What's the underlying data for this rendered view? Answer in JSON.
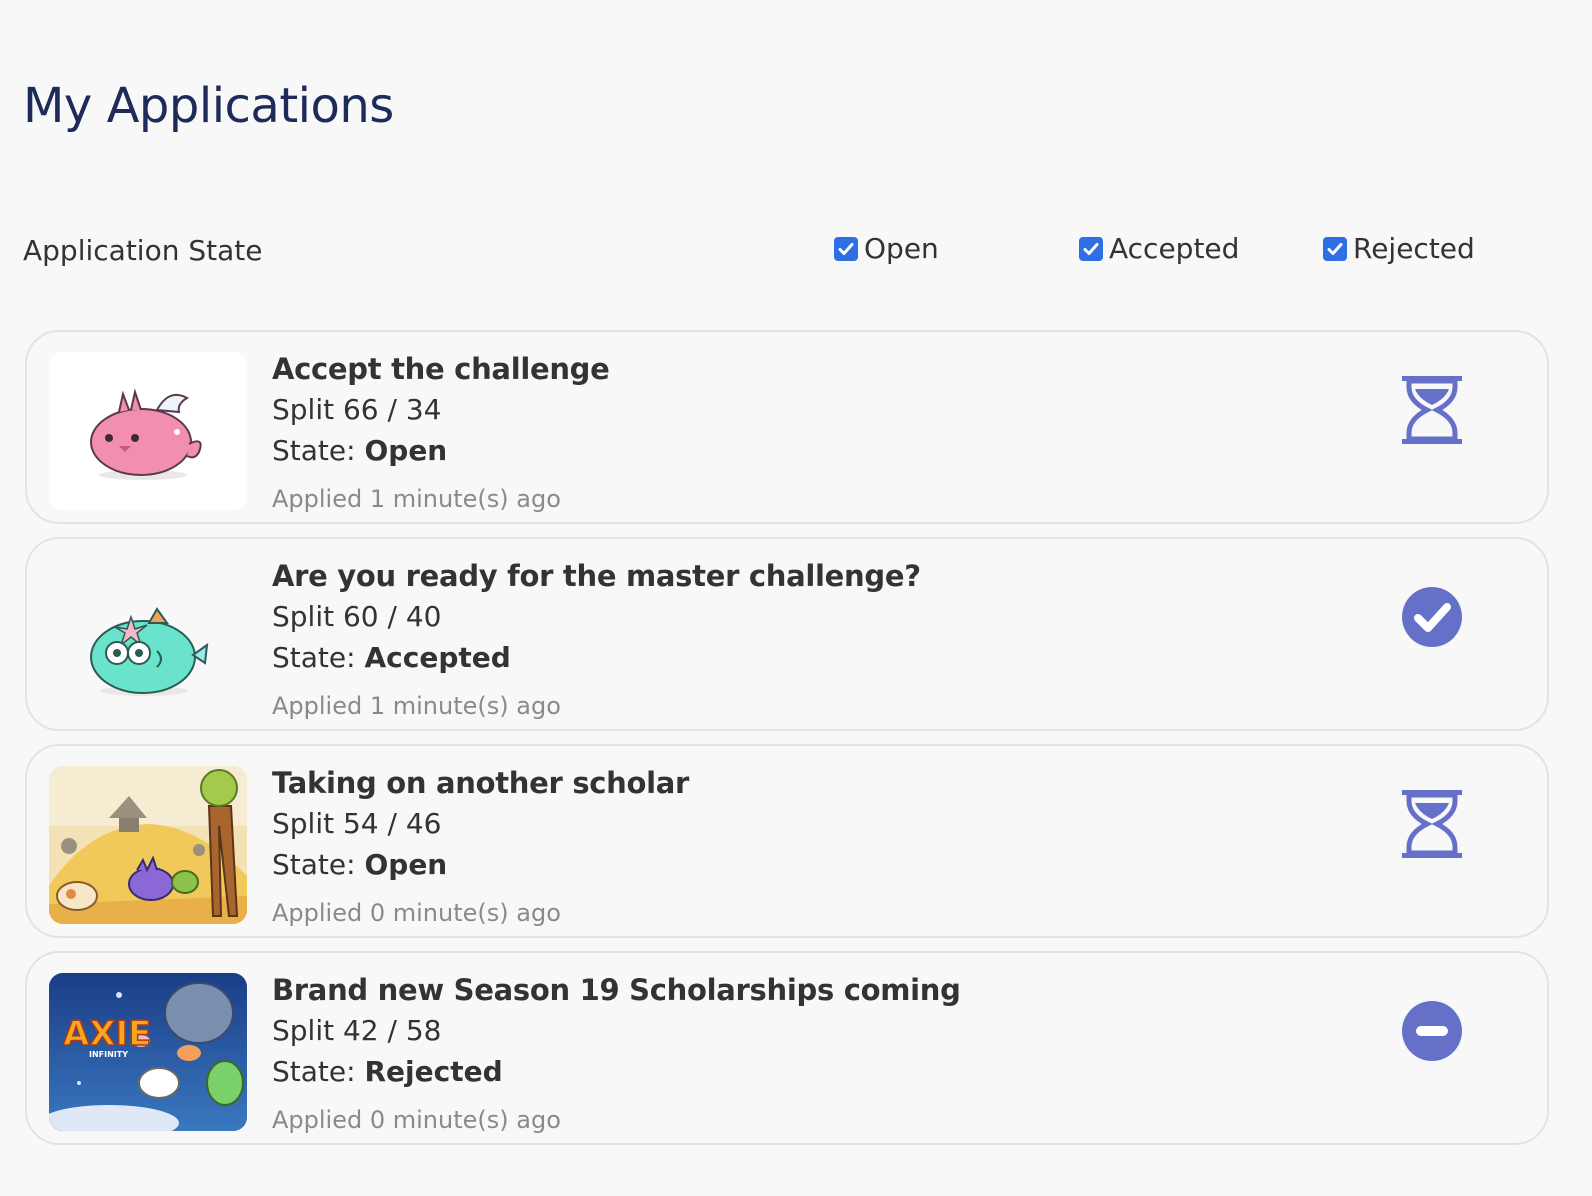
{
  "page": {
    "title": "My Applications"
  },
  "filters": {
    "label": "Application State",
    "options": [
      {
        "label": "Open",
        "checked": true
      },
      {
        "label": "Accepted",
        "checked": true
      },
      {
        "label": "Rejected",
        "checked": true
      }
    ]
  },
  "applications": [
    {
      "title": "Accept the challenge",
      "split": "Split 66 / 34",
      "state_prefix": "State:",
      "state": "Open",
      "applied": "Applied 1 minute(s) ago",
      "status_icon": "hourglass-icon",
      "thumbnail": "pink-axie-icon"
    },
    {
      "title": "Are you ready for the master challenge?",
      "split": "Split 60 / 40",
      "state_prefix": "State:",
      "state": "Accepted",
      "applied": "Applied 1 minute(s) ago",
      "status_icon": "check-circle-icon",
      "thumbnail": "teal-axie-icon"
    },
    {
      "title": "Taking on another scholar",
      "split": "Split 54 / 46",
      "state_prefix": "State:",
      "state": "Open",
      "applied": "Applied 0 minute(s) ago",
      "status_icon": "hourglass-icon",
      "thumbnail": "game-scene-image"
    },
    {
      "title": "Brand new Season 19 Scholarships coming",
      "split": "Split 42 / 58",
      "state_prefix": "State:",
      "state": "Rejected",
      "applied": "Applied 0 minute(s) ago",
      "status_icon": "minus-circle-icon",
      "thumbnail": "axie-infinity-banner",
      "thumbnail_logo_text": "AXIE",
      "thumbnail_logo_subtext": "INFINITY"
    }
  ],
  "colors": {
    "accent": "#6571c8",
    "title": "#1e2a5a",
    "checkbox": "#2f6fe4"
  }
}
